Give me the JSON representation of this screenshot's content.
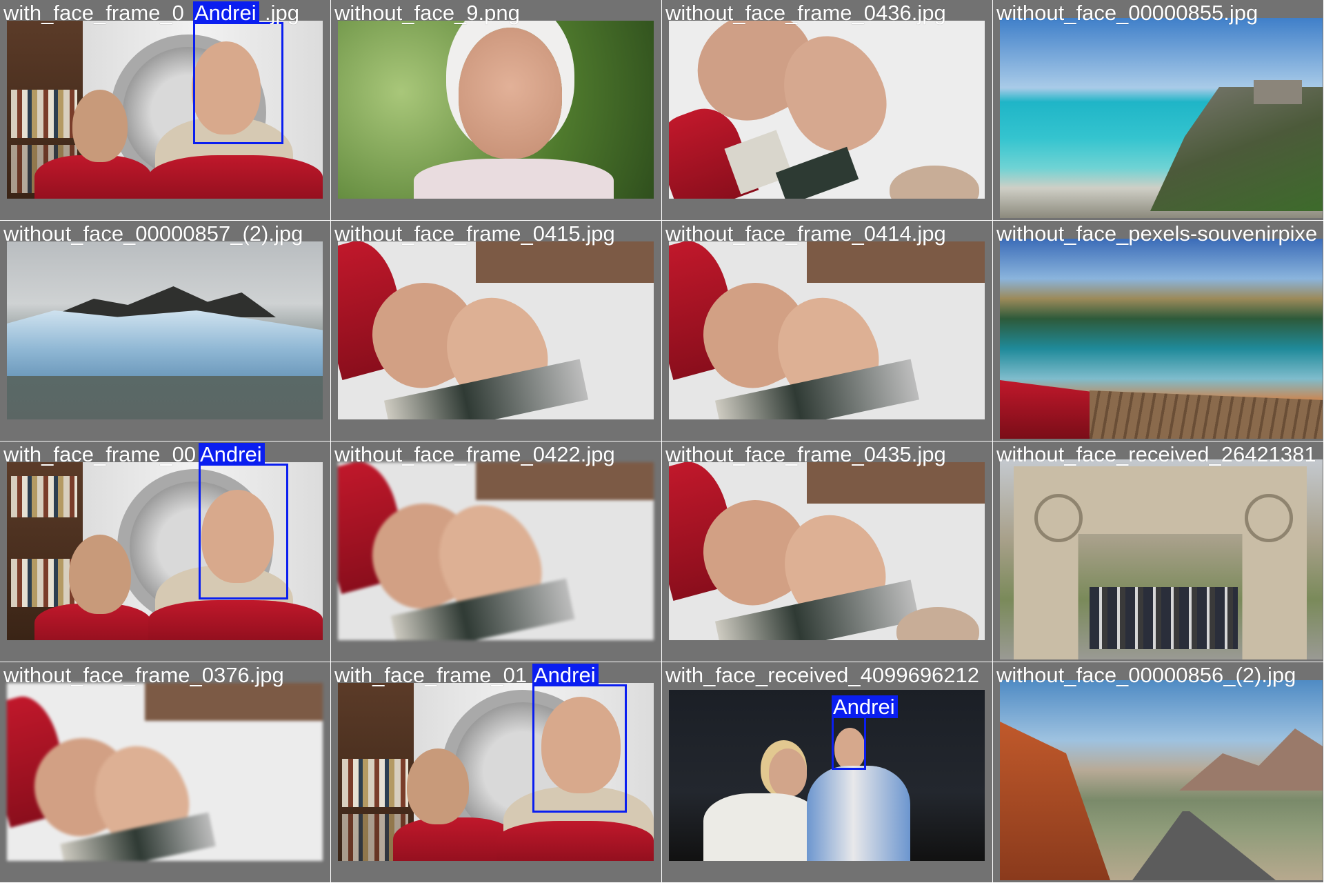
{
  "tiles": [
    {
      "caption": "with_face_frame_0",
      "caption_tail": ".jpg",
      "boxes": [
        "Andrei"
      ]
    },
    {
      "caption": "without_face_9.png",
      "boxes": []
    },
    {
      "caption": "without_face_frame_0436.jpg",
      "boxes": []
    },
    {
      "caption": "without_face_00000855.jpg",
      "boxes": []
    },
    {
      "caption": "without_face_00000857_(2).jpg",
      "boxes": []
    },
    {
      "caption": "without_face_frame_0415.jpg",
      "boxes": []
    },
    {
      "caption": "without_face_frame_0414.jpg",
      "boxes": []
    },
    {
      "caption": "without_face_pexels-souvenirpixe",
      "boxes": []
    },
    {
      "caption": "with_face_frame_00",
      "boxes": [
        "Andrei"
      ]
    },
    {
      "caption": "without_face_frame_0422.jpg",
      "boxes": []
    },
    {
      "caption": "without_face_frame_0435.jpg",
      "boxes": []
    },
    {
      "caption": "without_face_received_26421381",
      "boxes": []
    },
    {
      "caption": "without_face_frame_0376.jpg",
      "boxes": []
    },
    {
      "caption": "with_face_frame_01",
      "boxes": [
        "Andrei"
      ]
    },
    {
      "caption": "with_face_received_4099696212",
      "boxes": [
        "Andrei"
      ]
    },
    {
      "caption": "without_face_00000856_(2).jpg",
      "boxes": []
    }
  ],
  "colors": {
    "box": "#0a1ef0",
    "tile_bg": "#727272",
    "caption": "#ffffff"
  }
}
